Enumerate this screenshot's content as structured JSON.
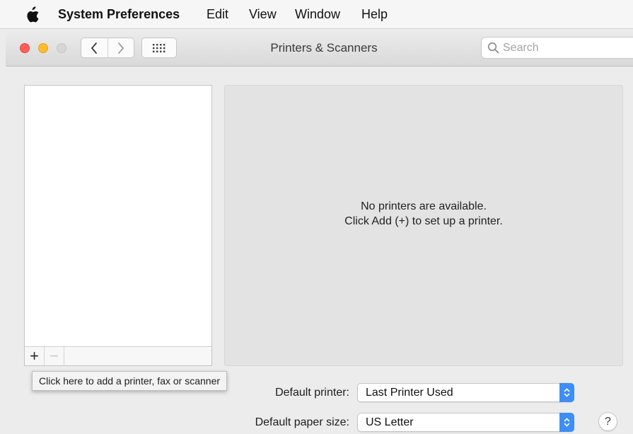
{
  "menubar": {
    "apple_icon": "apple-logo-icon",
    "app_name": "System Preferences",
    "items": [
      "Edit",
      "View",
      "Window",
      "Help"
    ]
  },
  "window": {
    "title": "Printers & Scanners",
    "back_icon": "chevron-left-icon",
    "forward_icon": "chevron-right-icon",
    "grid_icon": "grid-dots-icon",
    "traffic_colors": {
      "close": "#ff5f57",
      "minimize": "#ffbd2e",
      "zoom": "#d6d6d6"
    }
  },
  "search": {
    "icon": "search-icon",
    "placeholder": "Search",
    "value": ""
  },
  "printer_list": {
    "items": [],
    "add_label": "+",
    "remove_label": "−"
  },
  "detail": {
    "empty_line1": "No printers are available.",
    "empty_line2": "Click Add (+) to set up a printer."
  },
  "tooltip": {
    "text": "Click here to add a printer, fax or scanner"
  },
  "settings": {
    "default_printer_label": "Default printer:",
    "default_printer_value": "Last Printer Used",
    "default_paper_label": "Default paper size:",
    "default_paper_value": "US Letter",
    "accent_color": "#3d8ef7"
  },
  "help": {
    "label": "?"
  }
}
